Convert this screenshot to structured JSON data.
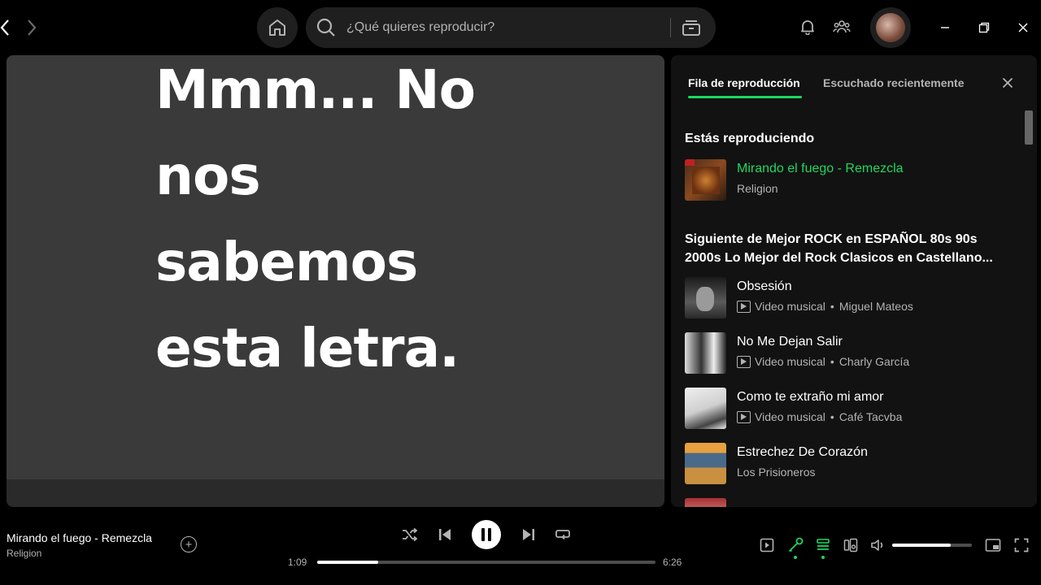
{
  "header": {
    "search_placeholder": "¿Qué quieres reproducir?"
  },
  "lyrics": {
    "lines": [
      "Mmm... No",
      "nos",
      "sabemos",
      "esta letra."
    ]
  },
  "queue": {
    "tabs": [
      "Fila de reproducción",
      "Escuchado recientemente"
    ],
    "now_playing_heading": "Estás reproduciendo",
    "now_playing": {
      "title": "Mirando el fuego - Remezcla",
      "artist": "Religion"
    },
    "next_heading": "Siguiente de Mejor ROCK en ESPAÑOL 80s 90s 2000s Lo Mejor del Rock Clasicos en Castellano...",
    "items": [
      {
        "title": "Obsesión",
        "type": "Video musical",
        "artist": "Miguel Mateos"
      },
      {
        "title": "No Me Dejan Salir",
        "type": "Video musical",
        "artist": "Charly García"
      },
      {
        "title": "Como te extraño mi amor",
        "type": "Video musical",
        "artist": "Café Tacvba"
      },
      {
        "title": "Estrechez De Corazón",
        "type": "",
        "artist": "Los Prisioneros"
      }
    ]
  },
  "player": {
    "title": "Mirando el fuego - Remezcla",
    "artist": "Religion",
    "elapsed": "1:09",
    "duration": "6:26",
    "progress_fraction": 0.18,
    "volume_fraction": 0.73
  },
  "colors": {
    "accent": "#1ed760",
    "background": "#000000",
    "panel": "#121212",
    "lyrics_bg": "#3a3a3a"
  }
}
